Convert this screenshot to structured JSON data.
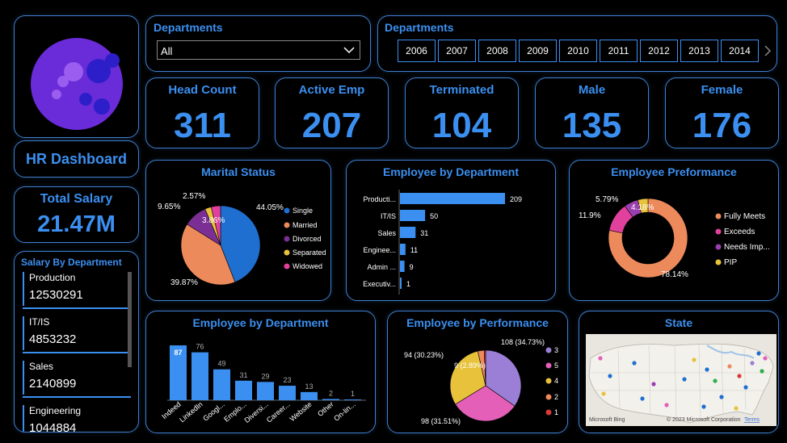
{
  "sidebar": {
    "title": "HR Dashboard",
    "total_salary_label": "Total Salary",
    "total_salary_value": "21.47M",
    "salary_by_dept_title": "Salary By Department",
    "salary_items": [
      {
        "name": "Production",
        "value": "12530291"
      },
      {
        "name": "IT/IS",
        "value": "4853232"
      },
      {
        "name": "Sales",
        "value": "2140899"
      },
      {
        "name": "Engineering",
        "value": "1044884"
      }
    ]
  },
  "filters": {
    "dept_slicer_title": "Departments",
    "dept_slicer_value": "All",
    "year_slicer_title": "Departments",
    "years": [
      "2006",
      "2007",
      "2008",
      "2009",
      "2010",
      "2011",
      "2012",
      "2013",
      "2014"
    ]
  },
  "kpis": [
    {
      "label": "Head Count",
      "value": "311"
    },
    {
      "label": "Active Emp",
      "value": "207"
    },
    {
      "label": "Terminated",
      "value": "104"
    },
    {
      "label": "Male",
      "value": "135"
    },
    {
      "label": "Female",
      "value": "176"
    }
  ],
  "colors": {
    "accent": "#3b8ff0",
    "border": "#3f7fd0",
    "background": "#000000"
  },
  "icons": {
    "logo": "moon-logo-icon",
    "dropdown": "chevron-down-icon",
    "scroll": "chevron-right-icon"
  },
  "map": {
    "title": "State",
    "attribution": "© 2023 Microsoft Corporation",
    "terms": "Terms",
    "brand": "Microsoft Bing"
  },
  "chart_data": [
    {
      "type": "pie",
      "title": "Marital Status",
      "legend": [
        "Single",
        "Married",
        "Divorced",
        "Separated",
        "Widowed"
      ],
      "values": [
        44.05,
        39.87,
        9.65,
        2.57,
        3.86
      ],
      "labels": [
        "44.05%",
        "39.87%",
        "9.65%",
        "2.57%",
        "3.86%"
      ],
      "colors": [
        "#1f6fd1",
        "#ec8a5c",
        "#7b2f94",
        "#e7c23a",
        "#e1419c"
      ]
    },
    {
      "type": "bar",
      "orientation": "horizontal",
      "title": "Employee by Department",
      "categories": [
        "Producti...",
        "IT/IS",
        "Sales",
        "Enginee...",
        "Admin ...",
        "Executiv..."
      ],
      "values": [
        209,
        50,
        31,
        11,
        9,
        1
      ]
    },
    {
      "type": "pie",
      "subtype": "donut",
      "title": "Employee Preformance",
      "legend": [
        "Fully Meets",
        "Exceeds",
        "Needs Imp...",
        "PIP"
      ],
      "values": [
        78.14,
        11.9,
        5.79,
        4.18
      ],
      "labels": [
        "78.14%",
        "11.9%",
        "5.79%",
        "4.18%"
      ],
      "colors": [
        "#ec8a5c",
        "#e1419c",
        "#9b3fb0",
        "#e7c23a"
      ]
    },
    {
      "type": "bar",
      "title": "Employee by Department",
      "categories": [
        "Indeed",
        "LinkedIn",
        "Googl...",
        "Emplo...",
        "Diversi...",
        "Career...",
        "Website",
        "Other",
        "On-lin..."
      ],
      "values": [
        87,
        76,
        49,
        31,
        29,
        23,
        13,
        2,
        1
      ]
    },
    {
      "type": "pie",
      "title": "Employee by Performance",
      "legend": [
        "3",
        "5",
        "4",
        "2",
        "1"
      ],
      "values": [
        108,
        98,
        94,
        9,
        2
      ],
      "labels": [
        "108 (34.73%)",
        "98 (31.51%)",
        "94 (30.23%)",
        "9 (2.89%)"
      ],
      "colors": [
        "#9b7fd6",
        "#e35fb8",
        "#e7c23a",
        "#ec8a5c",
        "#d63a3a"
      ]
    }
  ]
}
